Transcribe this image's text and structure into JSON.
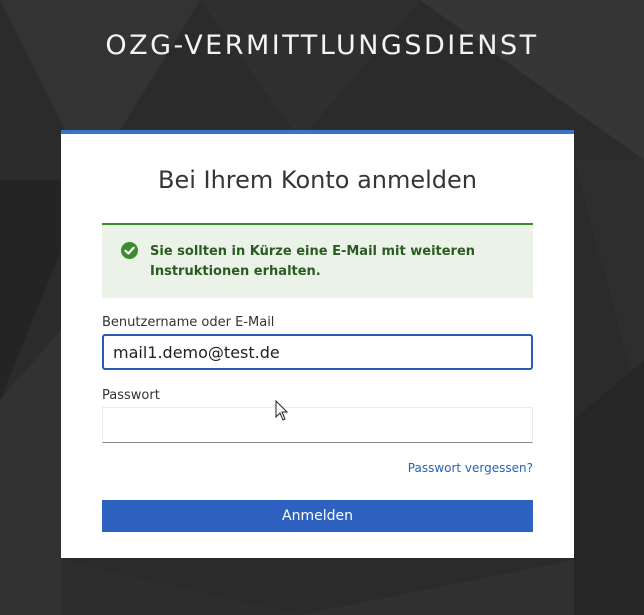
{
  "header": {
    "brand": "OZG-VERMITTLUNGSDIENST"
  },
  "card": {
    "title": "Bei Ihrem Konto anmelden"
  },
  "alert": {
    "type": "success",
    "icon": "check-circle-icon",
    "message": "Sie sollten in Kürze eine E-Mail mit weiteren Instruktionen erhalten."
  },
  "form": {
    "username_label": "Benutzername oder E-Mail",
    "username_value": "mail1.demo@test.de",
    "password_label": "Passwort",
    "password_value": "",
    "forgot_link": "Passwort vergessen?",
    "submit_label": "Anmelden"
  },
  "colors": {
    "accent": "#3b73c6",
    "button": "#2d62c0",
    "success": "#3c8c2d",
    "success_bg": "#ebf3e8",
    "link": "#2a62b8"
  }
}
